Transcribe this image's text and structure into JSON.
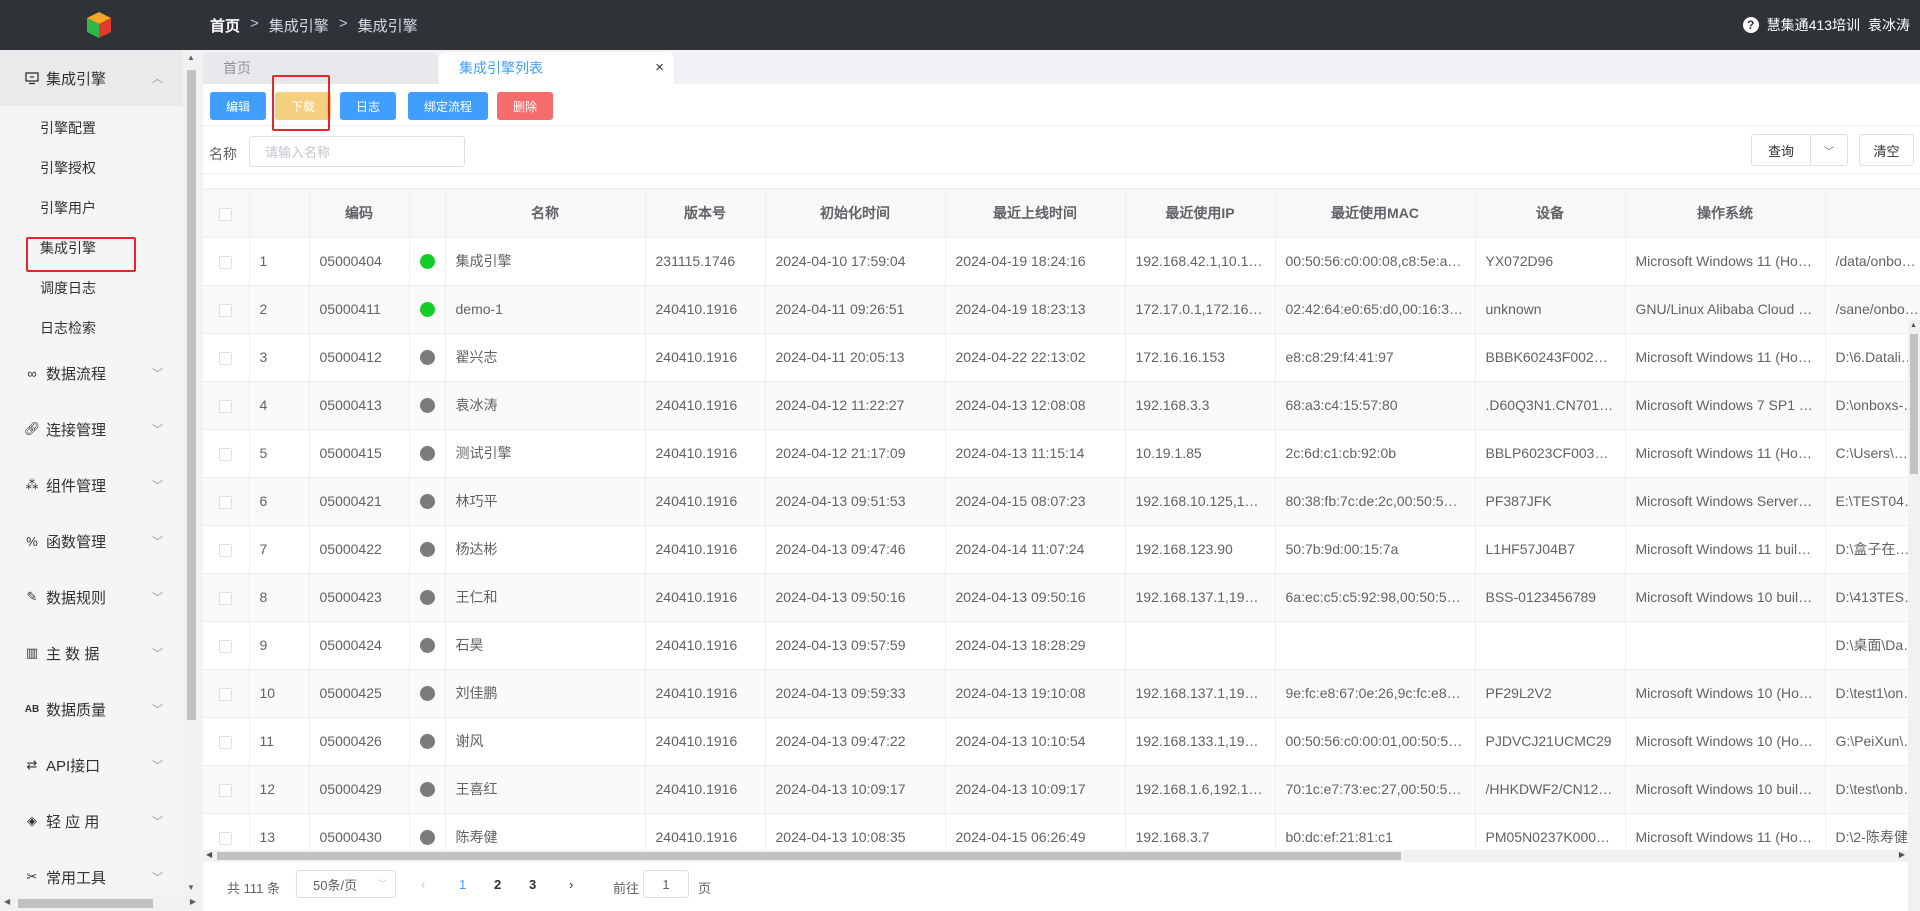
{
  "header": {
    "breadcrumb": [
      "首页",
      "集成引擎",
      "集成引擎"
    ],
    "breadcrumb_sep": ">",
    "help_glyph": "?",
    "org": "慧集通413培训",
    "user": "袁冰涛"
  },
  "sidebar": {
    "active_group": "集成引擎",
    "sub_items": [
      "引擎配置",
      "引擎授权",
      "引擎用户",
      "集成引擎",
      "调度日志",
      "日志检索"
    ],
    "groups": [
      {
        "label": "数据流程",
        "icon": "infinity-icon"
      },
      {
        "label": "连接管理",
        "icon": "link-icon"
      },
      {
        "label": "组件管理",
        "icon": "components-icon"
      },
      {
        "label": "函数管理",
        "icon": "percent-icon"
      },
      {
        "label": "数据规则",
        "icon": "wrench-icon"
      },
      {
        "label": "主 数 据",
        "icon": "map-icon"
      },
      {
        "label": "数据质量",
        "icon": "quality-icon"
      },
      {
        "label": "API接口",
        "icon": "swap-icon"
      },
      {
        "label": "轻 应 用",
        "icon": "cube-icon"
      },
      {
        "label": "常用工具",
        "icon": "tools-icon"
      }
    ]
  },
  "tabs": {
    "home": "首页",
    "active": "集成引擎列表",
    "close": "×"
  },
  "toolbar": {
    "edit": "编辑",
    "download": "下载",
    "log": "日志",
    "bind_flow": "绑定流程",
    "delete": "删除"
  },
  "search": {
    "label": "名称",
    "placeholder": "请输入名称",
    "query": "查询",
    "clear": "清空"
  },
  "table": {
    "columns": [
      "编码",
      "名称",
      "版本号",
      "初始化时间",
      "最近上线时间",
      "最近使用IP",
      "最近使用MAC",
      "设备",
      "操作系统"
    ],
    "rows": [
      {
        "idx": "1",
        "code": "05000404",
        "status": "online",
        "name": "集成引擎",
        "version": "231115.1746",
        "init": "2024-04-10 17:59:04",
        "online": "2024-04-19 18:24:16",
        "ip": "192.168.42.1,10.1…",
        "mac": "00:50:56:c0:00:08,c8:5e:a…",
        "device": "YX072D96",
        "os": "Microsoft Windows 11 (Ho…",
        "path": "/data/onbo…"
      },
      {
        "idx": "2",
        "code": "05000411",
        "status": "online",
        "name": "demo-1",
        "version": "240410.1916",
        "init": "2024-04-11 09:26:51",
        "online": "2024-04-19 18:23:13",
        "ip": "172.17.0.1,172.16…",
        "mac": "02:42:64:e0:65:d0,00:16:3…",
        "device": "unknown",
        "os": "GNU/Linux Alibaba Cloud …",
        "path": "/sane/onbo…"
      },
      {
        "idx": "3",
        "code": "05000412",
        "status": "offline",
        "name": "翟兴志",
        "version": "240410.1916",
        "init": "2024-04-11 20:05:13",
        "online": "2024-04-22 22:13:02",
        "ip": "172.16.16.153",
        "mac": "e8:c8:29:f4:41:97",
        "device": "BBBK60243F002…",
        "os": "Microsoft Windows 11 (Ho…",
        "path": "D:\\6.Datali…"
      },
      {
        "idx": "4",
        "code": "05000413",
        "status": "offline",
        "name": "袁冰涛",
        "version": "240410.1916",
        "init": "2024-04-12 11:22:27",
        "online": "2024-04-13 12:08:08",
        "ip": "192.168.3.3",
        "mac": "68:a3:c4:15:57:80",
        "device": ".D60Q3N1.CN701…",
        "os": "Microsoft Windows 7 SP1 …",
        "path": "D:\\onboxs-…"
      },
      {
        "idx": "5",
        "code": "05000415",
        "status": "offline",
        "name": "测试引擎",
        "version": "240410.1916",
        "init": "2024-04-12 21:17:09",
        "online": "2024-04-13 11:15:14",
        "ip": "10.19.1.85",
        "mac": "2c:6d:c1:cb:92:0b",
        "device": "BBLP6023CF003…",
        "os": "Microsoft Windows 11 (Ho…",
        "path": "C:\\Users\\…"
      },
      {
        "idx": "6",
        "code": "05000421",
        "status": "offline",
        "name": "林巧平",
        "version": "240410.1916",
        "init": "2024-04-13 09:51:53",
        "online": "2024-04-15 08:07:23",
        "ip": "192.168.10.125,1…",
        "mac": "80:38:fb:7c:de:2c,00:50:5…",
        "device": "PF387JFK",
        "os": "Microsoft Windows Server…",
        "path": "E:\\TEST04…"
      },
      {
        "idx": "7",
        "code": "05000422",
        "status": "offline",
        "name": "杨达彬",
        "version": "240410.1916",
        "init": "2024-04-13 09:47:46",
        "online": "2024-04-14 11:07:24",
        "ip": "192.168.123.90",
        "mac": "50:7b:9d:00:15:7a",
        "device": "L1HF57J04B7",
        "os": "Microsoft Windows 11 buil…",
        "path": "D:\\盒子在…"
      },
      {
        "idx": "8",
        "code": "05000423",
        "status": "offline",
        "name": "王仁和",
        "version": "240410.1916",
        "init": "2024-04-13 09:50:16",
        "online": "2024-04-13 09:50:16",
        "ip": "192.168.137.1,19…",
        "mac": "6a:ec:c5:c5:92:98,00:50:5…",
        "device": "BSS-0123456789",
        "os": "Microsoft Windows 10 buil…",
        "path": "D:\\413TES…"
      },
      {
        "idx": "9",
        "code": "05000424",
        "status": "offline",
        "name": "石昊",
        "version": "240410.1916",
        "init": "2024-04-13 09:57:59",
        "online": "2024-04-13 18:28:29",
        "ip": "",
        "mac": "",
        "device": "",
        "os": "",
        "path": "D:\\桌面\\Da…"
      },
      {
        "idx": "10",
        "code": "05000425",
        "status": "offline",
        "name": "刘佳鹏",
        "version": "240410.1916",
        "init": "2024-04-13 09:59:33",
        "online": "2024-04-13 19:10:08",
        "ip": "192.168.137.1,19…",
        "mac": "9e:fc:e8:67:0e:26,9c:fc:e8…",
        "device": "PF29L2V2",
        "os": "Microsoft Windows 10 (Ho…",
        "path": "D:\\test1\\on…"
      },
      {
        "idx": "11",
        "code": "05000426",
        "status": "offline",
        "name": "谢风",
        "version": "240410.1916",
        "init": "2024-04-13 09:47:22",
        "online": "2024-04-13 10:10:54",
        "ip": "192.168.133.1,19…",
        "mac": "00:50:56:c0:00:01,00:50:5…",
        "device": "PJDVCJ21UCMC29",
        "os": "Microsoft Windows 10 (Ho…",
        "path": "G:\\PeiXun\\…"
      },
      {
        "idx": "12",
        "code": "05000429",
        "status": "offline",
        "name": "王喜红",
        "version": "240410.1916",
        "init": "2024-04-13 10:09:17",
        "online": "2024-04-13 10:09:17",
        "ip": "192.168.1.6,192.1…",
        "mac": "70:1c:e7:73:ec:27,00:50:5…",
        "device": "/HHKDWF2/CN12…",
        "os": "Microsoft Windows 10 buil…",
        "path": "D:\\test\\onb…"
      },
      {
        "idx": "13",
        "code": "05000430",
        "status": "offline",
        "name": "陈寿健",
        "version": "240410.1916",
        "init": "2024-04-13 10:08:35",
        "online": "2024-04-15 06:26:49",
        "ip": "192.168.3.7",
        "mac": "b0:dc:ef:21:81:c1",
        "device": "PM05N0237K000…",
        "os": "Microsoft Windows 11 (Ho…",
        "path": "D:\\2-陈寿健…"
      }
    ]
  },
  "pagination": {
    "total": "共 111 条",
    "page_size": "50条/页",
    "pages": [
      "1",
      "2",
      "3"
    ],
    "current": "1",
    "goto_label": "前往",
    "goto_value": "1",
    "page_unit": "页"
  },
  "colors": {
    "accent": "#409eff",
    "header_bg": "#2f3338",
    "highlight": "#e8242b",
    "online": "#13ce27",
    "offline": "#7b7b7b"
  }
}
